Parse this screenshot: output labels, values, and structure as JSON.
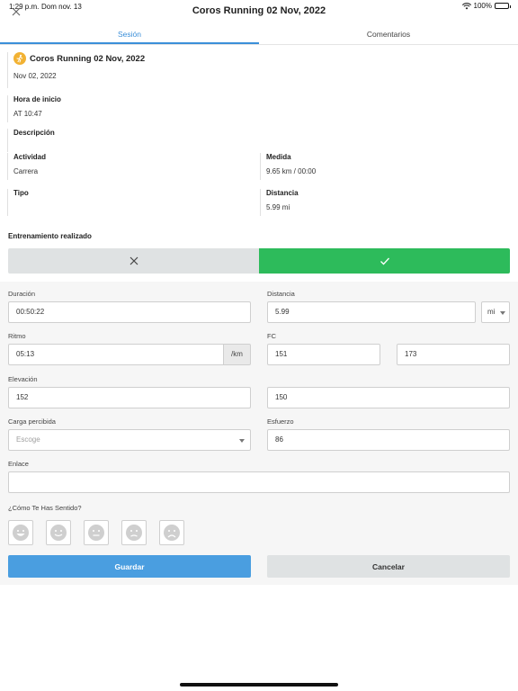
{
  "status_bar": {
    "time": "1:29 p.m.",
    "date": "Dom nov. 13",
    "battery": "100%"
  },
  "nav": {
    "title": "Coros Running 02 Nov, 2022"
  },
  "tabs": [
    {
      "label": "Sesión",
      "active": true
    },
    {
      "label": "Comentarios",
      "active": false
    }
  ],
  "session": {
    "title": "Coros Running 02 Nov, 2022",
    "date": "Nov 02, 2022",
    "start_label": "Hora de inicio",
    "start_value": "AT 10:47",
    "description_label": "Descripción",
    "activity_label": "Actividad",
    "activity_value": "Carrera",
    "measure_label": "Medida",
    "measure_value": "9.65 km / 00:00",
    "type_label": "Tipo",
    "distance_label": "Distancia",
    "distance_value": "5.99 mi"
  },
  "completed": {
    "label": "Entrenamiento realizado",
    "selected": "yes"
  },
  "form": {
    "duration_label": "Duración",
    "duration_value": "00:50:22",
    "distance_label": "Distancia",
    "distance_value": "5.99",
    "distance_unit": "mi",
    "pace_label": "Ritmo",
    "pace_value": "05:13",
    "pace_unit": "/km",
    "hr_label": "FC",
    "hr_value_1": "151",
    "hr_value_2": "173",
    "elevation_label": "Elevación",
    "elevation_value_1": "152",
    "elevation_value_2": "150",
    "load_label": "Carga percibida",
    "load_placeholder": "Escoge",
    "effort_label": "Esfuerzo",
    "effort_value": "86",
    "link_label": "Enlace",
    "link_value": "",
    "feeling_label": "¿Cómo Te Has Sentido?",
    "save_label": "Guardar",
    "cancel_label": "Cancelar"
  },
  "colors": {
    "accent": "#3b8fd9",
    "success": "#2dbb5b",
    "save": "#4a9ee0",
    "runner": "#f2b233"
  },
  "icons": [
    "close-icon",
    "runner-icon",
    "x-icon",
    "check-icon",
    "chevron-down-icon",
    "face-very-happy-icon",
    "face-happy-icon",
    "face-neutral-icon",
    "face-sad-icon",
    "face-very-sad-icon"
  ]
}
